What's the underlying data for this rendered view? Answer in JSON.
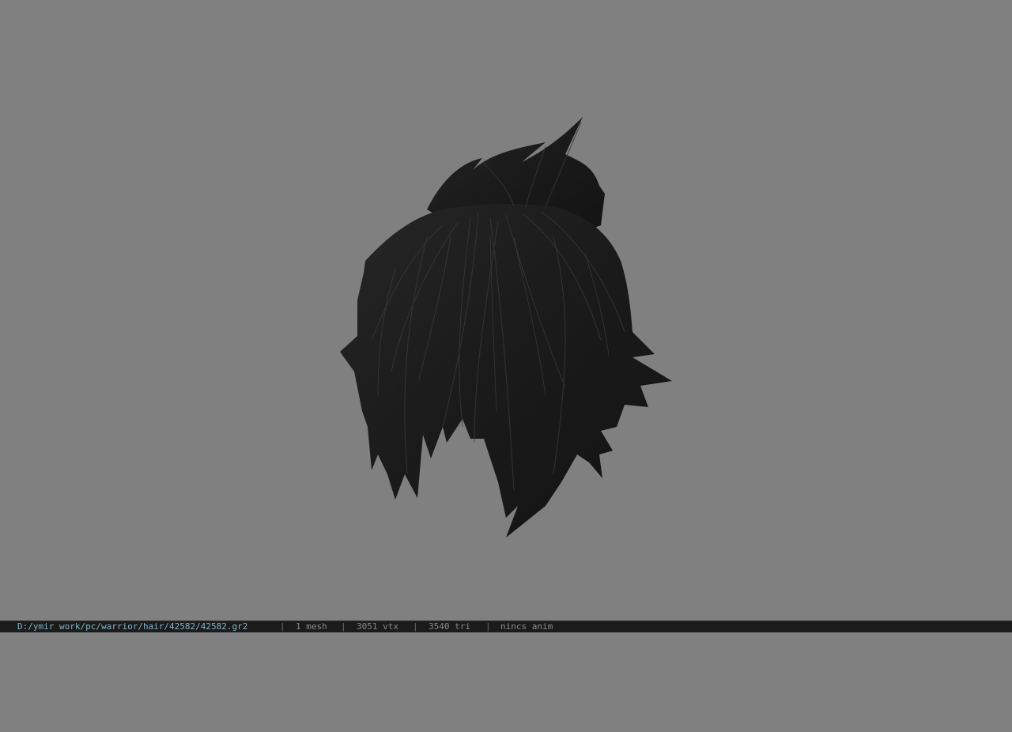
{
  "viewer": {
    "background_color": "#808080",
    "model": {
      "subject": "hair-mesh",
      "color": "#1c1c1c"
    }
  },
  "status_bar": {
    "file_path": "D:/ymir work/pc/warrior/hair/42582/42582.gr2",
    "separator": "|",
    "mesh_count": "1 mesh",
    "vertex_count": "3051 vtx",
    "triangle_count": "3540 tri",
    "anim_status": "nincs anim",
    "path_color": "#7fb6c9"
  }
}
